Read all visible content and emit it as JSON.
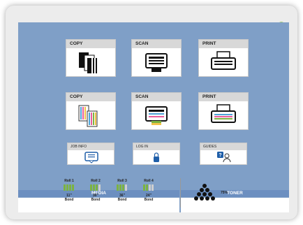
{
  "tiles": {
    "copy_bw": "COPY",
    "scan_bw": "SCAN",
    "print_bw": "PRINT",
    "copy_color": "COPY",
    "scan_color": "SCAN",
    "print_color": "PRINT"
  },
  "small_tiles": {
    "job_info": "JOB INFO",
    "log_in": "LOG IN",
    "guides": "GUIDES"
  },
  "media": {
    "label": "MEDIA",
    "rolls": [
      {
        "name": "Roll 1",
        "size": "11\"",
        "type": "Bond"
      },
      {
        "name": "Roll 2",
        "size": "30\"",
        "type": "Bond"
      },
      {
        "name": "Roll 3",
        "size": "36\"",
        "type": "Bond"
      },
      {
        "name": "Roll 4",
        "size": "24\"",
        "type": "Bond"
      }
    ]
  },
  "toner": {
    "label": "TONER",
    "percent": "75%"
  },
  "colors": {
    "screen_bg": "#7f9fc7",
    "bar": "#6c8fc0",
    "roll_ok": "#7cb342",
    "power": "#8bc34a"
  },
  "icons": [
    "kip-logo",
    "power-icon",
    "copy-icon",
    "scan-icon",
    "print-icon",
    "job-info-icon",
    "log-in-icon",
    "guides-icon",
    "roll-icon",
    "toner-icon"
  ]
}
